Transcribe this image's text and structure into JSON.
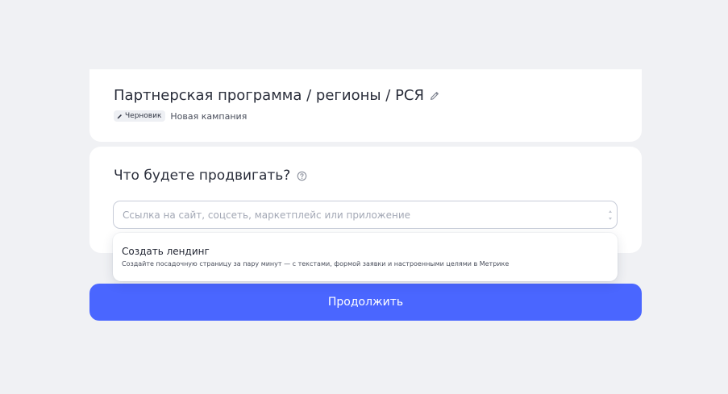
{
  "campaign": {
    "title": "Партнерская программа / регионы / РСЯ",
    "status_badge": "Черновик",
    "type": "Новая кампания"
  },
  "promote": {
    "title": "Что будете продвигать?",
    "input_value": "",
    "input_placeholder": "Ссылка на сайт, соцсеть, маркетплейс или приложение"
  },
  "dropdown": {
    "items": [
      {
        "title": "Создать лендинг",
        "description": "Создайте посадочную страницу за пару минут — с текстами, формой заявки и настроенными целями в Метрике"
      }
    ]
  },
  "actions": {
    "continue_label": "Продолжить"
  },
  "colors": {
    "background": "#f0f1f4",
    "card": "#ffffff",
    "primary": "#4a66ff",
    "text": "#2a2e3b",
    "muted": "#a3a8b5"
  },
  "icons": {
    "edit": "pencil-icon",
    "help": "help-icon"
  }
}
